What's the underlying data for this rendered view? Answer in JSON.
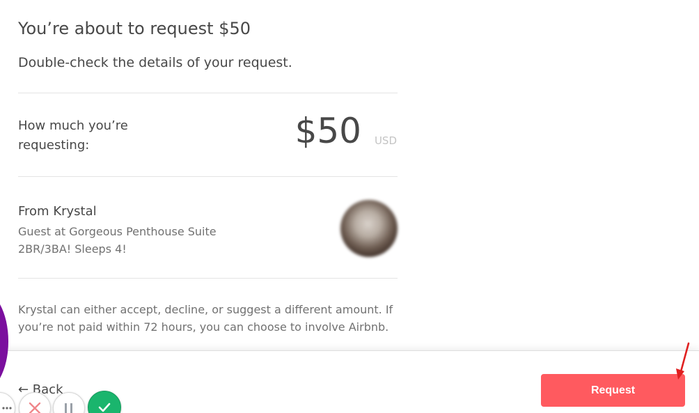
{
  "header": {
    "title": "You’re about to request $50",
    "subtitle": "Double-check the details of your request."
  },
  "amount": {
    "label": "How much you’re requesting:",
    "value": "$50",
    "currency": "USD"
  },
  "sender": {
    "name": "From Krystal",
    "detail": "Guest at Gorgeous Penthouse Suite 2BR/3BA! Sleeps 4!"
  },
  "notice": "Krystal can either accept, decline, or suggest a different amount. If you’re not paid within 72 hours, you can choose to involve Airbnb.",
  "footer": {
    "back_label": "← Back",
    "request_label": "Request"
  },
  "colors": {
    "primary": "#ff5a5f",
    "text": "#484848",
    "muted": "#717171",
    "success": "#1ab56d",
    "overlay_purple": "#7b0f9e",
    "annotation_arrow": "#e02020"
  },
  "icons": {
    "more": "more-dots-icon",
    "close": "close-x-icon",
    "pause": "pause-icon",
    "check": "checkmark-icon",
    "arrow": "annotation-arrow-icon"
  }
}
